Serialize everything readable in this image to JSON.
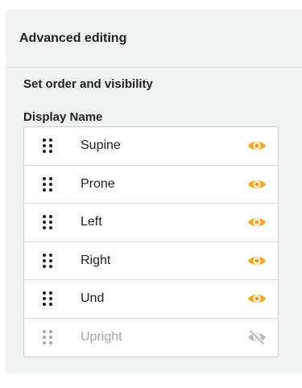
{
  "header": {
    "title": "Advanced editing"
  },
  "section": {
    "title": "Set order and visibility"
  },
  "list": {
    "column_label": "Display Name",
    "items": [
      {
        "label": "Supine",
        "visible": true
      },
      {
        "label": "Prone",
        "visible": true
      },
      {
        "label": "Left",
        "visible": true
      },
      {
        "label": "Right",
        "visible": true
      },
      {
        "label": "Und",
        "visible": true
      },
      {
        "label": "Upright",
        "visible": false
      }
    ]
  },
  "colors": {
    "eye_visible": "#f5a623",
    "eye_hidden": "#b9bcbe",
    "panel_bg": "#f1f3f3"
  },
  "icons": {
    "drag": "drag-handle-icon",
    "visible": "eye-icon",
    "hidden": "eye-off-icon"
  }
}
